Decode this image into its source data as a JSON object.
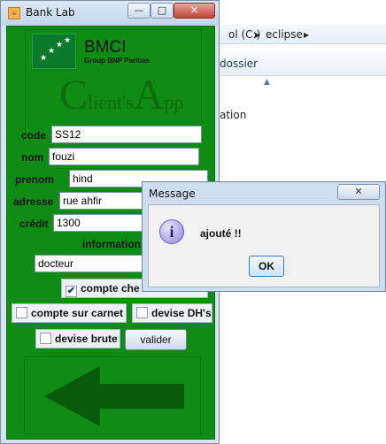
{
  "background": {
    "crumbs": [
      "ol (C:)",
      "eclipse"
    ],
    "toolbar_text": "dossier",
    "file_text": "ation"
  },
  "window": {
    "title": "Bank Lab",
    "min_glyph": "—",
    "max_glyph": "□",
    "close_glyph": "✕"
  },
  "logo": {
    "brand": "BMCI",
    "subtitle": "Group BNP Paribas",
    "app_c": "C",
    "app_lients": "lient's",
    "app_a": "A",
    "app_pp": "pp"
  },
  "form": {
    "code_label": "code",
    "code_value": "SS12",
    "nom_label": "nom",
    "nom_value": "fouzi",
    "prenom_label": "prenom",
    "prenom_value": "hind",
    "adresse_label": "adresse",
    "adresse_value": "rue ahfir",
    "credit_label": "crédit",
    "credit_value": "1300",
    "information_label": "information",
    "information_value": "docteur",
    "compte_cheque_label": "compte che",
    "compte_cheque_checked": true,
    "compte_carnet_label": "compte sur carnet",
    "devise_dh_label": "devise DH's",
    "devise_brute_label": "devise brute",
    "valider_label": "valider"
  },
  "dialog": {
    "title": "Message",
    "close_glyph": "✕",
    "message": "ajouté !!",
    "ok_label": "OK"
  },
  "colors": {
    "panel_green": "#0f8c14",
    "arrow_green": "#0a5a0c"
  }
}
